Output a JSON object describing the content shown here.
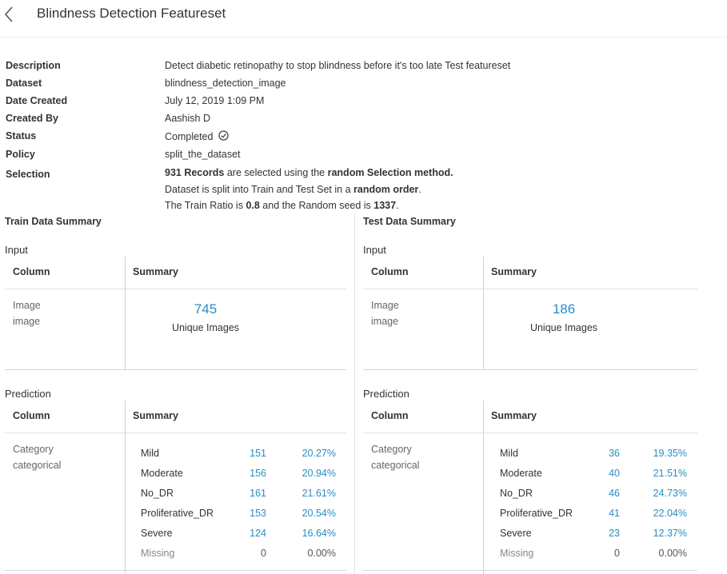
{
  "header": {
    "title": "Blindness Detection Featureset"
  },
  "meta": [
    {
      "label": "Description",
      "value": "Detect diabetic retinopathy to stop blindness before it's too late Test featureset"
    },
    {
      "label": "Dataset",
      "value": "blindness_detection_image"
    },
    {
      "label": "Date Created",
      "value": "July 12, 2019 1:09 PM"
    },
    {
      "label": "Created By",
      "value": "Aashish D"
    },
    {
      "label": "Status",
      "value": "Completed"
    },
    {
      "label": "Policy",
      "value": "split_the_dataset"
    },
    {
      "label": "Selection",
      "value": ""
    }
  ],
  "selection": {
    "line1": {
      "records": "931 Records",
      "mid": " are selected using the ",
      "method": "random Selection method."
    },
    "line2": {
      "pre": "Dataset is split into Train and Test Set in a ",
      "order": "random order",
      "post": "."
    },
    "line3": {
      "pre": "The Train Ratio is ",
      "ratio": "0.8",
      "mid": " and the Random seed is ",
      "seed": "1337",
      "post": "."
    }
  },
  "train": {
    "title": "Train Data Summary",
    "input_label": "Input",
    "col_header": "Column",
    "summary_header": "Summary",
    "input_col_name": "Image",
    "input_col_type": "image",
    "unique_count": "745",
    "unique_label": "Unique Images",
    "prediction_label": "Prediction",
    "pred_col_name": "Category",
    "pred_col_type": "categorical",
    "rows": [
      {
        "cat": "Mild",
        "count": "151",
        "pct": "20.27%"
      },
      {
        "cat": "Moderate",
        "count": "156",
        "pct": "20.94%"
      },
      {
        "cat": "No_DR",
        "count": "161",
        "pct": "21.61%"
      },
      {
        "cat": "Proliferative_DR",
        "count": "153",
        "pct": "20.54%"
      },
      {
        "cat": "Severe",
        "count": "124",
        "pct": "16.64%"
      },
      {
        "cat": "Missing",
        "count": "0",
        "pct": "0.00%"
      }
    ]
  },
  "test": {
    "title": "Test Data Summary",
    "input_label": "Input",
    "col_header": "Column",
    "summary_header": "Summary",
    "input_col_name": "Image",
    "input_col_type": "image",
    "unique_count": "186",
    "unique_label": "Unique Images",
    "prediction_label": "Prediction",
    "pred_col_name": "Category",
    "pred_col_type": "categorical",
    "rows": [
      {
        "cat": "Mild",
        "count": "36",
        "pct": "19.35%"
      },
      {
        "cat": "Moderate",
        "count": "40",
        "pct": "21.51%"
      },
      {
        "cat": "No_DR",
        "count": "46",
        "pct": "24.73%"
      },
      {
        "cat": "Proliferative_DR",
        "count": "41",
        "pct": "22.04%"
      },
      {
        "cat": "Severe",
        "count": "23",
        "pct": "12.37%"
      },
      {
        "cat": "Missing",
        "count": "0",
        "pct": "0.00%"
      }
    ]
  },
  "icons": {
    "back": "chevron-left-icon",
    "status": "check-circle-icon"
  },
  "colors": {
    "accent": "#2b8cc4",
    "text": "#333333",
    "divider": "#e0e0e0"
  }
}
